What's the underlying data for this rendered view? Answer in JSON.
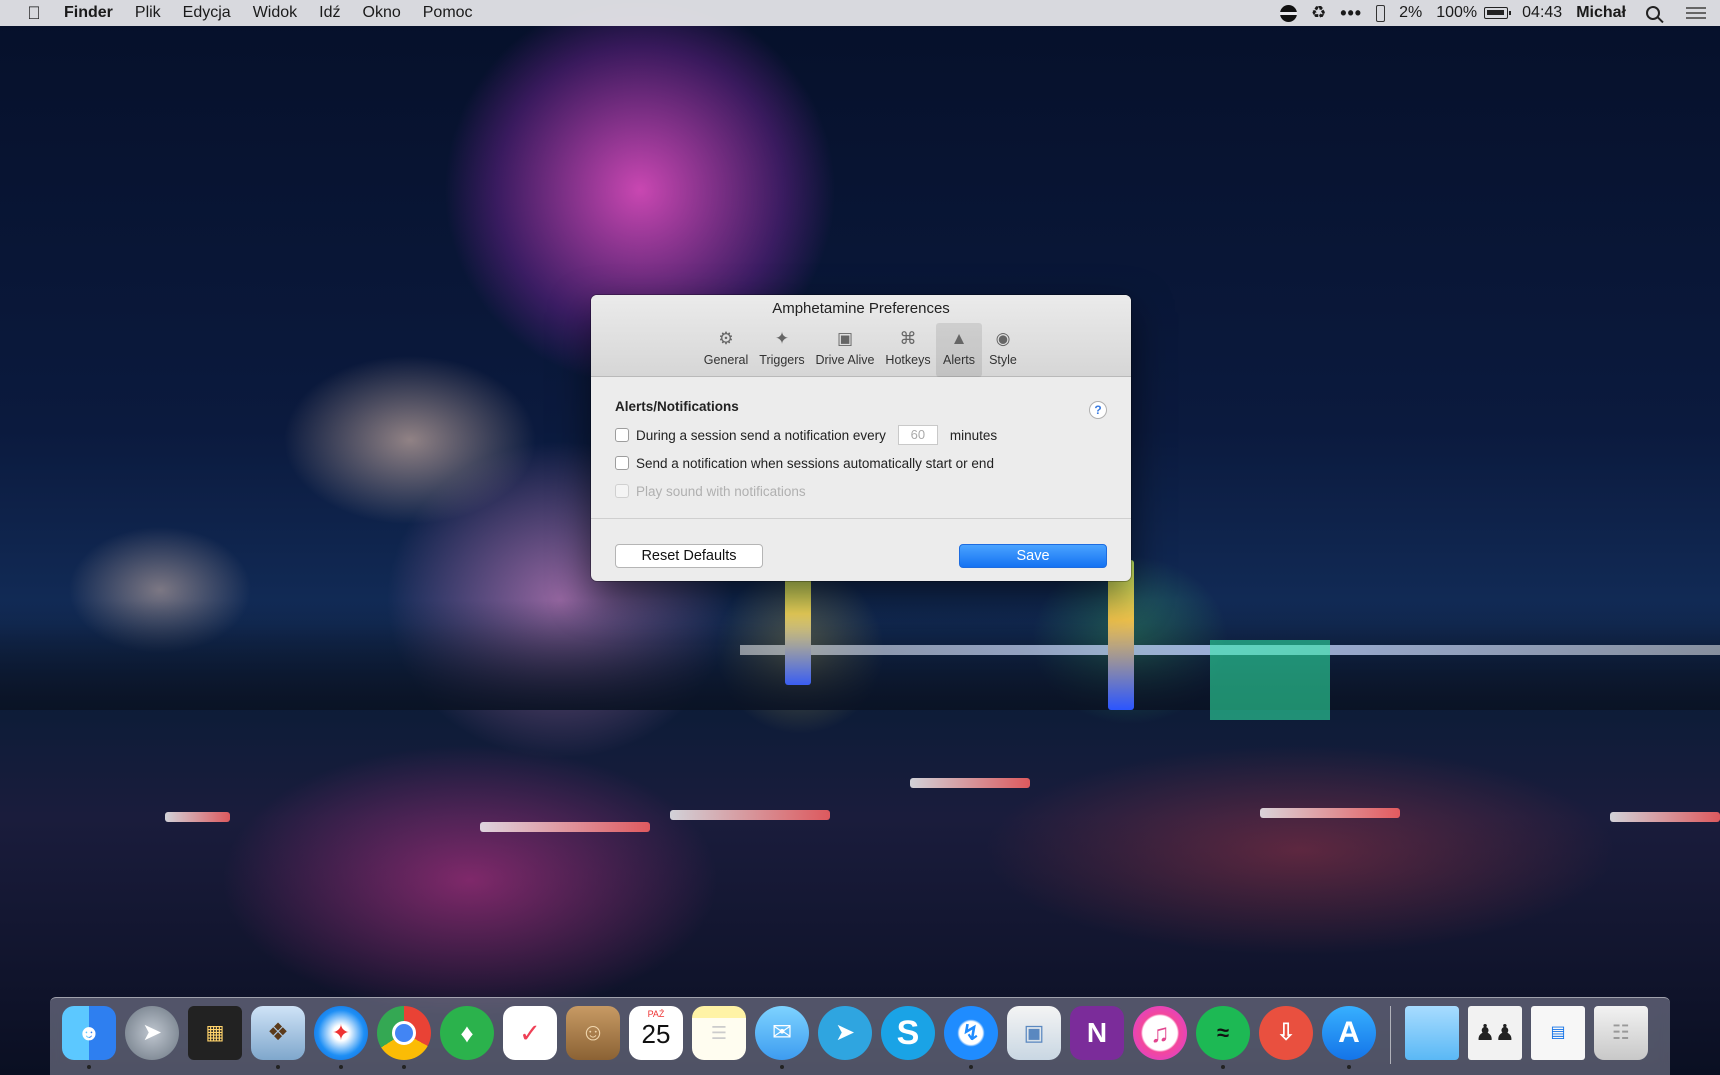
{
  "menubar": {
    "app_name": "Finder",
    "menus": [
      "Plik",
      "Edycja",
      "Widok",
      "Idź",
      "Okno",
      "Pomoc"
    ],
    "status": {
      "percent_small": "2%",
      "battery": "100%",
      "clock": "04:43",
      "user": "Michał"
    }
  },
  "window": {
    "title": "Amphetamine Preferences",
    "tabs": [
      {
        "label": "General",
        "icon": "gear-icon"
      },
      {
        "label": "Triggers",
        "icon": "wand-icon"
      },
      {
        "label": "Drive Alive",
        "icon": "drive-icon"
      },
      {
        "label": "Hotkeys",
        "icon": "command-icon"
      },
      {
        "label": "Alerts",
        "icon": "bell-icon",
        "active": true
      },
      {
        "label": "Style",
        "icon": "eye-icon"
      }
    ],
    "section_title": "Alerts/Notifications",
    "help_label": "?",
    "options": {
      "notify_every_label": "During a session send a notification every",
      "notify_every_value": "60",
      "notify_every_unit": "minutes",
      "auto_session_label": "Send a notification when sessions automatically start or end",
      "play_sound_label": "Play sound with notifications"
    },
    "buttons": {
      "reset": "Reset Defaults",
      "save": "Save"
    }
  },
  "dock": {
    "calendar_month": "PAŹ",
    "calendar_day": "25",
    "apps": [
      "finder-icon",
      "launchpad-icon",
      "mission-control-icon",
      "preview-icon",
      "safari-icon",
      "chrome-icon",
      "feedly-icon",
      "pocket-icon",
      "contacts-icon",
      "calendar-icon",
      "notes-icon",
      "messages-icon",
      "telegram-icon",
      "skype-icon",
      "messenger-icon",
      "photo-app-icon",
      "onenote-icon",
      "itunes-icon",
      "spotify-icon",
      "downloader-icon",
      "app-store-icon"
    ]
  }
}
